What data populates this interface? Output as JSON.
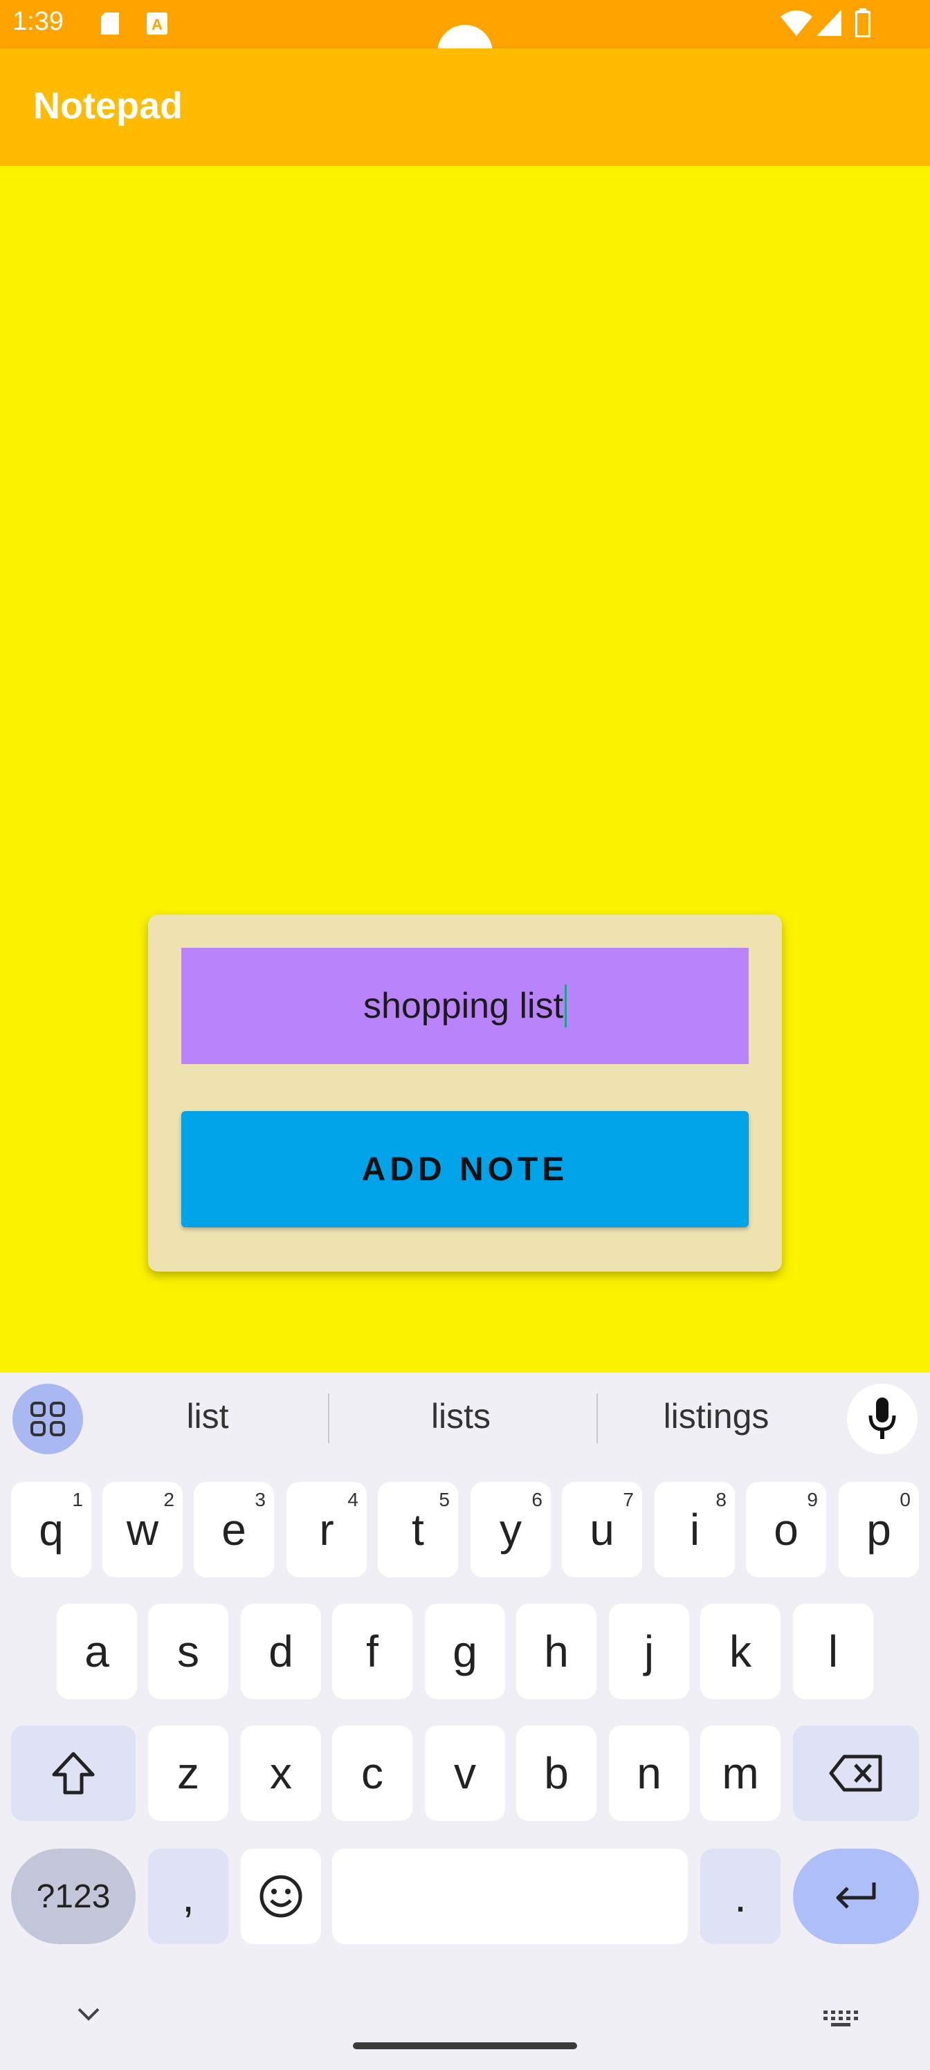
{
  "status_bar": {
    "time": "1:39",
    "icons": [
      "sd-card-icon",
      "text-a-icon",
      "wifi-icon",
      "signal-icon",
      "battery-icon"
    ]
  },
  "app_bar": {
    "title": "Notepad"
  },
  "note_form": {
    "input_value": "shopping list",
    "add_button_label": "ADD NOTE"
  },
  "keyboard": {
    "suggestions": [
      "list",
      "lists",
      "listings"
    ],
    "row1": [
      {
        "key": "q",
        "hint": "1"
      },
      {
        "key": "w",
        "hint": "2"
      },
      {
        "key": "e",
        "hint": "3"
      },
      {
        "key": "r",
        "hint": "4"
      },
      {
        "key": "t",
        "hint": "5"
      },
      {
        "key": "y",
        "hint": "6"
      },
      {
        "key": "u",
        "hint": "7"
      },
      {
        "key": "i",
        "hint": "8"
      },
      {
        "key": "o",
        "hint": "9"
      },
      {
        "key": "p",
        "hint": "0"
      }
    ],
    "row2": [
      "a",
      "s",
      "d",
      "f",
      "g",
      "h",
      "j",
      "k",
      "l"
    ],
    "row3": [
      "z",
      "x",
      "c",
      "v",
      "b",
      "n",
      "m"
    ],
    "symbols_label": "?123",
    "comma_label": ",",
    "period_label": "."
  },
  "colors": {
    "status_bar": "#ffa300",
    "app_bar": "#ffbb00",
    "background": "#fbf200",
    "card": "#ede2b0",
    "input": "#b883fb",
    "button": "#00a2e8"
  }
}
